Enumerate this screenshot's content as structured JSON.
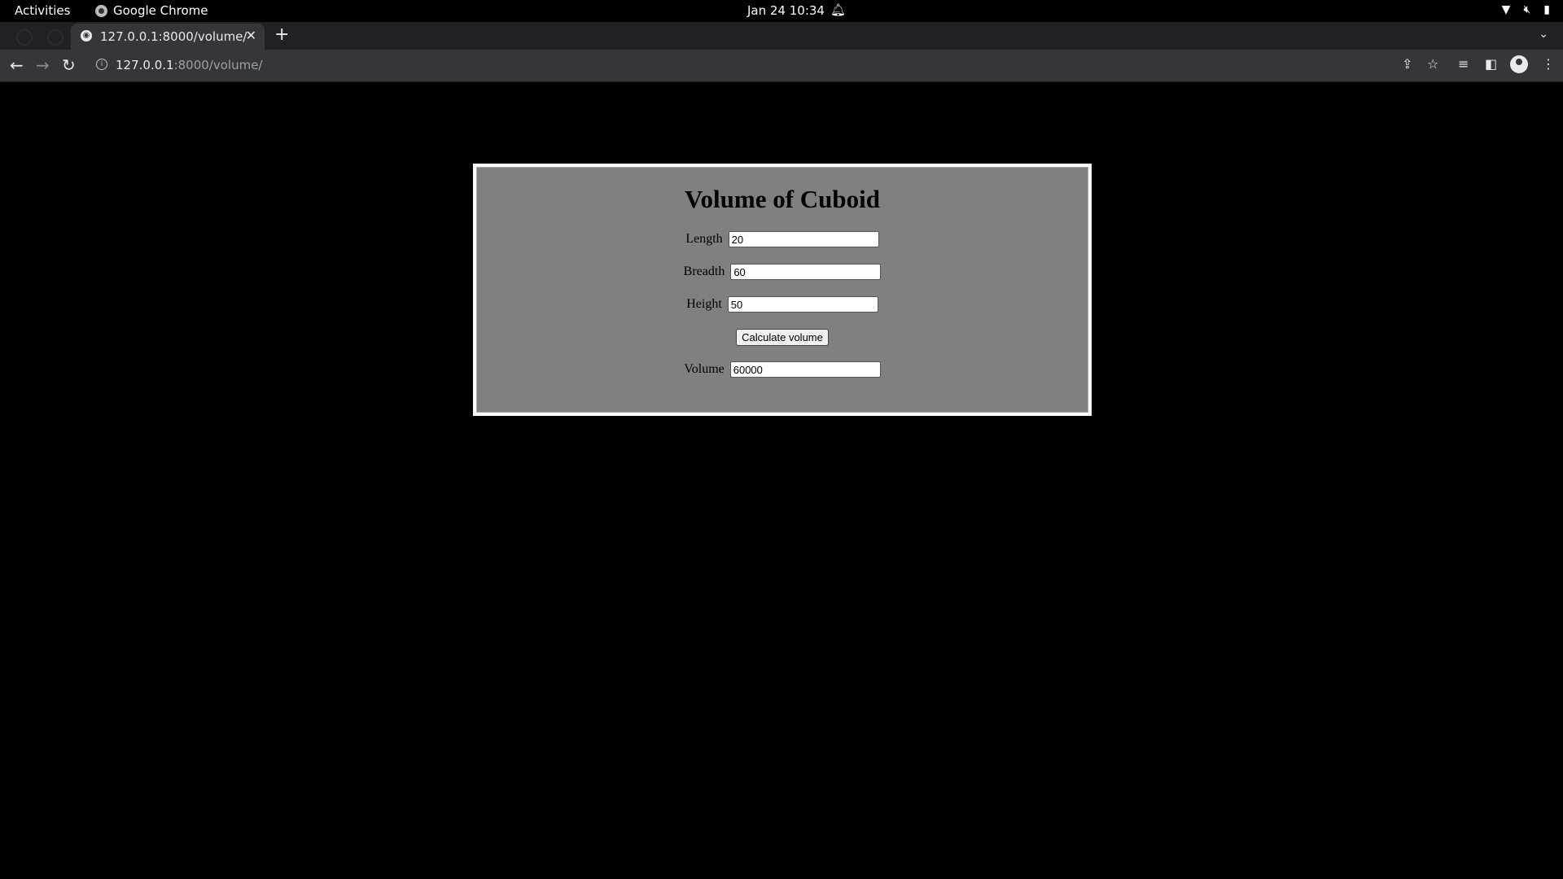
{
  "os_bar": {
    "activities": "Activities",
    "app_name": "Google Chrome",
    "clock": "Jan 24  10:34"
  },
  "browser": {
    "tab_title": "127.0.0.1:8000/volume/",
    "url_host": "127.0.0.1",
    "url_path": ":8000/volume/"
  },
  "page": {
    "heading": "Volume of Cuboid",
    "length_label": "Length",
    "length_value": "20",
    "breadth_label": "Breadth",
    "breadth_value": "60",
    "height_label": "Height",
    "height_value": "50",
    "button_label": "Calculate volume",
    "volume_label": "Volume",
    "volume_value": "60000"
  },
  "icons": {
    "notification": "bell-icon",
    "network": "wifi-icon",
    "sound": "volume-muted-icon",
    "power": "battery-icon",
    "tab_favicon": "globe-icon"
  },
  "colors": {
    "page_background": "#000000",
    "card_background": "#808080",
    "card_border": "#ffffff"
  }
}
